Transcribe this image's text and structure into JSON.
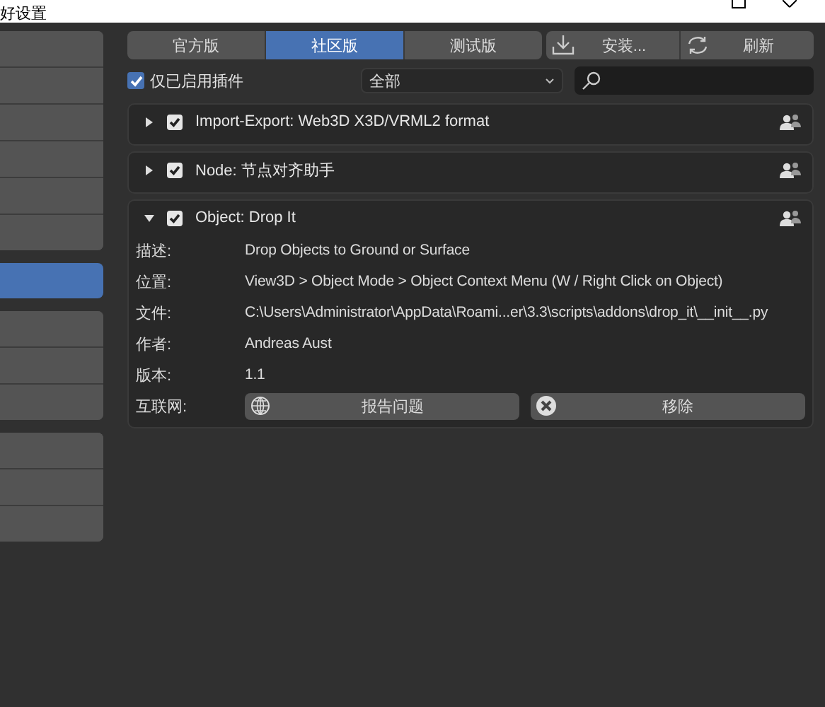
{
  "window": {
    "title": "好设置"
  },
  "sidebar": {
    "groups": [
      [
        {
          "selected": false
        },
        {
          "selected": false
        },
        {
          "selected": false
        },
        {
          "selected": false
        },
        {
          "selected": false
        },
        {
          "selected": false
        }
      ],
      [
        {
          "selected": true
        }
      ],
      [
        {
          "selected": false
        },
        {
          "selected": false
        },
        {
          "selected": false
        }
      ],
      [
        {
          "selected": false
        },
        {
          "selected": false
        },
        {
          "selected": false
        }
      ]
    ]
  },
  "tabs": [
    {
      "label": "官方版",
      "selected": false
    },
    {
      "label": "社区版",
      "selected": true
    },
    {
      "label": "测试版",
      "selected": false
    }
  ],
  "actions": [
    {
      "label": "安装...",
      "kind": "install"
    },
    {
      "label": "刷新",
      "kind": "refresh"
    }
  ],
  "filter": {
    "enabled_only": {
      "label": "仅已启用插件",
      "checked": true
    },
    "category": "全部"
  },
  "addons": [
    {
      "name": "Import-Export: Web3D X3D/VRML2 format",
      "enabled": true,
      "expanded": false
    },
    {
      "name": "Node: 节点对齐助手",
      "enabled": true,
      "expanded": false
    },
    {
      "name": "Object: Drop It",
      "enabled": true,
      "expanded": true,
      "details": [
        {
          "label": "描述:",
          "value": "Drop Objects to Ground or Surface"
        },
        {
          "label": "位置:",
          "value": "View3D > Object Mode > Object Context Menu (W / Right Click on Object)"
        },
        {
          "label": "文件:",
          "value": "C:\\Users\\Administrator\\AppData\\Roami...er\\3.3\\scripts\\addons\\drop_it\\__init__.py"
        },
        {
          "label": "作者:",
          "value": "Andreas Aust"
        },
        {
          "label": "版本:",
          "value": "1.1"
        }
      ],
      "links_label": "互联网:",
      "buttons": [
        {
          "label": "报告问题",
          "kind": "report"
        },
        {
          "label": "移除",
          "kind": "remove"
        }
      ]
    }
  ]
}
